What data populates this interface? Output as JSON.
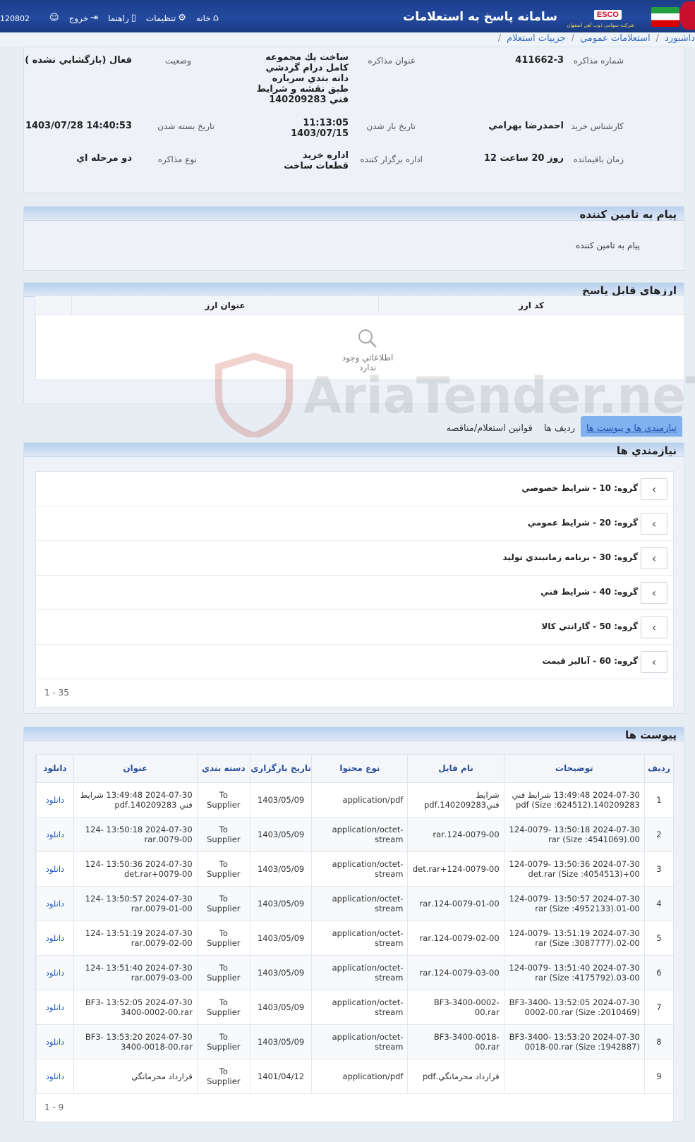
{
  "header": {
    "app_title": "سامانه پاسخ به استعلامات",
    "esco": "ESCO",
    "sub_brand": "شرکت سهامی ذوب آهن اصفهان",
    "nav": [
      {
        "label": "خانه",
        "icon": "home-icon"
      },
      {
        "label": "تنظیمات",
        "icon": "gear-icon"
      },
      {
        "label": "راهنما",
        "icon": "book-icon"
      },
      {
        "label": "خروج",
        "icon": "logout-icon"
      }
    ],
    "user_id": "120802"
  },
  "breadcrumb": [
    "داشبورد",
    "استعلامات عمومي",
    "جزييات استعلام"
  ],
  "info": {
    "tender_no_label": "شماره مذاكره",
    "tender_no": "411662-3",
    "title_label": "عنوان مذاكره",
    "title": "ساخت يك مجموعه كامل درام گردشي دانه بندي سرباره طبق نقشه و شرايط فني 140209283",
    "status_label": "وضعيت",
    "status": "فعال (بازگشايي نشده )",
    "buyer_label": "كارشناس خريد",
    "buyer": "احمدرضا بهرامي",
    "open_date_label": "تاريخ باز شدن",
    "open_time": "11:13:05",
    "open_date": "1403/07/15",
    "close_date_label": "تاريخ بسته شدن",
    "close_date": "1403/07/28 14:40:53",
    "remaining_label": "زمان باقيمانده",
    "remaining": "12 روز 20 ساعت",
    "dept_label": "اداره برگزار كننده",
    "dept": "اداره خريد قطعات ساخت",
    "type_label": "نوع مذاكره",
    "type": "دو مرحله اي"
  },
  "message": {
    "title": "پيام به تامين كننده",
    "label": "پيام به تامين كننده"
  },
  "currencies": {
    "title": "ارزهاي قابل پاسخ",
    "col_code": "كد ارز",
    "col_title": "عنوان ارز",
    "empty": "اطلاعاتي وجود ندارد"
  },
  "tabs": [
    "نيازمندي ها و پيوست ها",
    "رديف ها",
    "قوانين استعلام/مناقصه"
  ],
  "requirements": {
    "title": "نيازمندي ها",
    "groups": [
      "گروه: 10 - شرايط خصوصي",
      "گروه: 20 - شرايط عمومي",
      "گروه: 30 - برنامه زمانبندي توليد",
      "گروه: 40 - شرايط فني",
      "گروه: 50 - گارانتي كالا",
      "گروه: 60 - آناليز قيمت"
    ],
    "pager": "1 - 35"
  },
  "attachments": {
    "title": "پيوست ها",
    "columns": [
      "رديف",
      "توضيحات",
      "نام فايل",
      "نوع محتوا",
      "تاريخ بارگزاري",
      "دسته بندي",
      "عنوان",
      "دانلود"
    ],
    "rows": [
      [
        "1",
        "2024-07-30 13:49:48 شرايط فني 140209283.pdf (Size :624512)",
        "شرايط فني140209283.pdf",
        "application/pdf",
        "1403/05/09",
        "To Supplier",
        "2024-07-30 13:49:48 شرايط فني 140209283.pdf",
        "دانلود"
      ],
      [
        "2",
        "2024-07-30 13:50:18 -124-0079 00.rar (Size :4541069)",
        "124-0079-00.rar",
        "application/octet-stream",
        "1403/05/09",
        "To Supplier",
        "2024-07-30 13:50:18 -124 0079-00.rar",
        "دانلود"
      ],
      [
        "3",
        "2024-07-30 13:50:36 -124-0079 00+det.rar (Size :4054513)",
        "124-0079-00+det.rar",
        "application/octet-stream",
        "1403/05/09",
        "To Supplier",
        "2024-07-30 13:50:36 -124 0079-00+det.rar",
        "دانلود"
      ],
      [
        "4",
        "2024-07-30 13:50:57 -124-0079 01-00.rar (Size :4952133)",
        "124-0079-01-00.rar",
        "application/octet-stream",
        "1403/05/09",
        "To Supplier",
        "2024-07-30 13:50:57 -124 0079-01-00.rar",
        "دانلود"
      ],
      [
        "5",
        "2024-07-30 13:51:19 -124-0079 02-00.rar (Size :3087777)",
        "124-0079-02-00.rar",
        "application/octet-stream",
        "1403/05/09",
        "To Supplier",
        "2024-07-30 13:51:19 -124 0079-02-00.rar",
        "دانلود"
      ],
      [
        "6",
        "2024-07-30 13:51:40 -124-0079 03-00.rar (Size :4175792)",
        "124-0079-03-00.rar",
        "application/octet-stream",
        "1403/05/09",
        "To Supplier",
        "2024-07-30 13:51:40 -124 0079-03-00.rar",
        "دانلود"
      ],
      [
        "7",
        "2024-07-30 13:52:05 -BF3-3400 0002-00.rar (Size :2010469)",
        "BF3-3400-0002-00.rar",
        "application/octet-stream",
        "1403/05/09",
        "To Supplier",
        "2024-07-30 13:52:05 -BF3 3400-0002-00.rar",
        "دانلود"
      ],
      [
        "8",
        "2024-07-30 13:53:20 -BF3-3400 0018-00.rar (Size :1942887)",
        "BF3-3400-0018-00.rar",
        "application/octet-stream",
        "1403/05/09",
        "To Supplier",
        "2024-07-30 13:53:20 -BF3 3400-0018-00.rar",
        "دانلود"
      ],
      [
        "9",
        "",
        "قرارداد محرمانگي.pdf",
        "application/pdf",
        "1401/04/12",
        "To Supplier",
        "قرارداد محرمانگي",
        "دانلود"
      ]
    ],
    "pager": "1 - 9"
  },
  "watermark": "AriaTender.neT"
}
